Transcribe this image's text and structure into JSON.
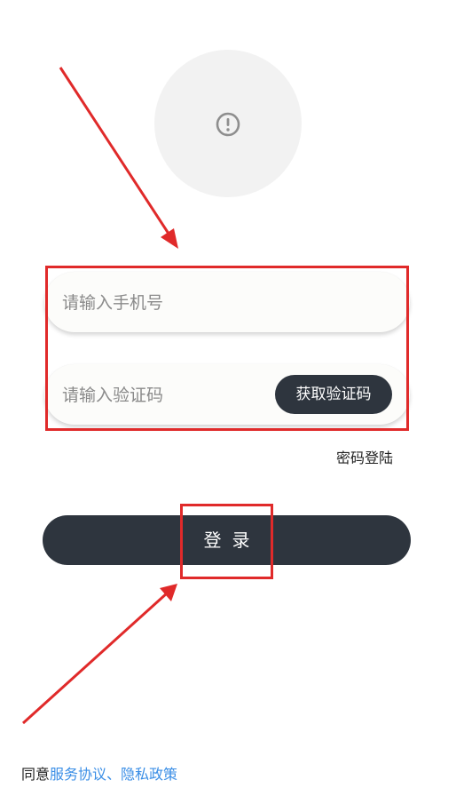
{
  "avatar": {
    "icon": "alert-circle-icon"
  },
  "form": {
    "phone_placeholder": "请输入手机号",
    "code_placeholder": "请输入验证码",
    "get_code_label": "获取验证码",
    "password_login_label": "密码登陆",
    "login_label": "登录"
  },
  "agreement": {
    "prefix": "同意",
    "links": "服务协议、隐私政策"
  },
  "colors": {
    "primary_button": "#2e353e",
    "link": "#3a8ee6",
    "annotation": "#e02a2a",
    "avatar_bg": "#f2f2f2"
  }
}
